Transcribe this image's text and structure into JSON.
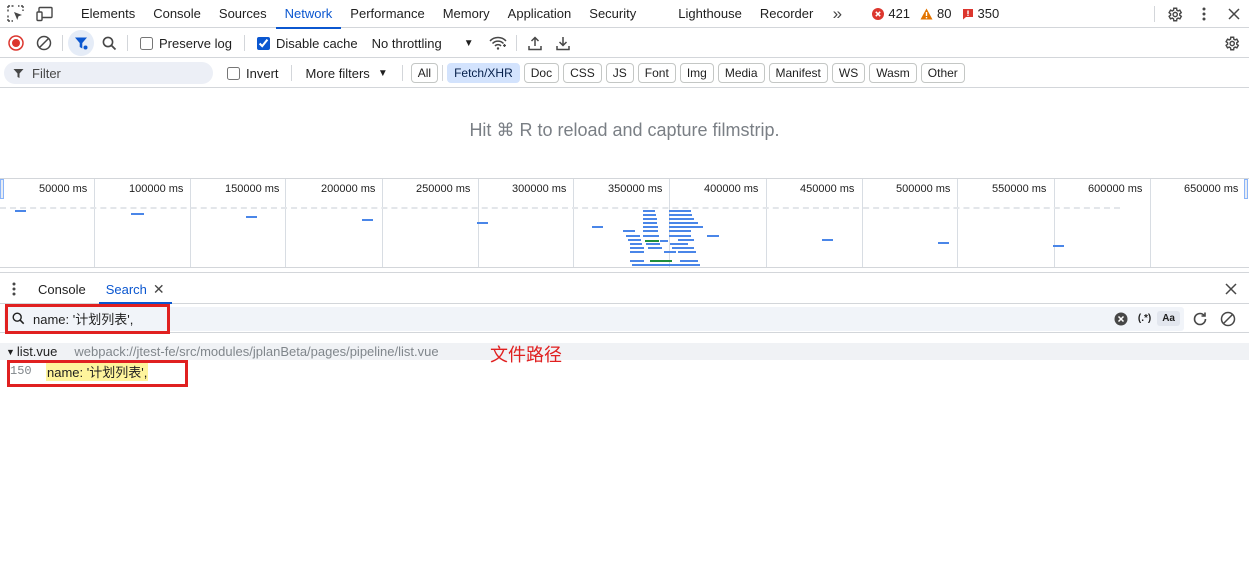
{
  "top_tabs": [
    {
      "label": "Elements"
    },
    {
      "label": "Console"
    },
    {
      "label": "Sources"
    },
    {
      "label": "Network",
      "active": true
    },
    {
      "label": "Performance"
    },
    {
      "label": "Memory"
    },
    {
      "label": "Application"
    },
    {
      "label": "Security"
    },
    {
      "label": "Lighthouse"
    },
    {
      "label": "Recorder"
    }
  ],
  "more_tabs_icon": "chevron-double-right",
  "counters": {
    "errors": "421",
    "warnings": "80",
    "issues": "350"
  },
  "toolbar": {
    "preserve_log": "Preserve log",
    "preserve_log_checked": false,
    "disable_cache": "Disable cache",
    "disable_cache_checked": true,
    "throttling": "No throttling"
  },
  "filter": {
    "placeholder": "Filter",
    "invert": "Invert",
    "more_filters": "More filters",
    "types": [
      "All",
      "Fetch/XHR",
      "Doc",
      "CSS",
      "JS",
      "Font",
      "Img",
      "Media",
      "Manifest",
      "WS",
      "Wasm",
      "Other"
    ],
    "active_type": "Fetch/XHR"
  },
  "filmstrip_hint": "Hit ⌘ R to reload and capture filmstrip.",
  "overview": {
    "ticks": [
      "50000 ms",
      "100000 ms",
      "150000 ms",
      "200000 ms",
      "250000 ms",
      "300000 ms",
      "350000 ms",
      "400000 ms",
      "450000 ms",
      "500000 ms",
      "550000 ms",
      "600000 ms",
      "650000 ms"
    ]
  },
  "drawer": {
    "tabs": [
      {
        "label": "Console"
      },
      {
        "label": "Search",
        "active": true
      }
    ],
    "search_query": "name: '计划列表',",
    "regex_label": "(.*)",
    "case_label": "Aa",
    "result": {
      "file": "list.vue",
      "path": "webpack://jtest-fe/src/modules/jplanBeta/pages/pipeline/list.vue",
      "line_number": "150",
      "match": "name: '计划列表',"
    }
  },
  "annotation_text": "文件路径",
  "colors": {
    "accent": "#0b57d0",
    "annotation": "#e02020",
    "match_highlight": "#fef49c",
    "error": "#dc362e",
    "warning": "#e37400"
  }
}
